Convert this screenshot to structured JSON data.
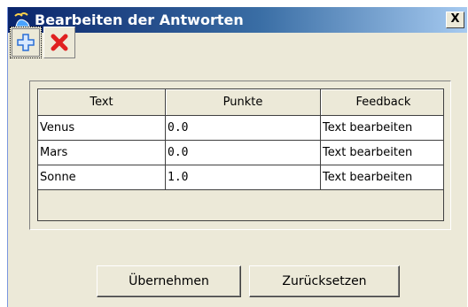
{
  "window": {
    "title": "Bearbeiten der Antworten"
  },
  "titlebar": {
    "close_label": "X"
  },
  "toolbar": {
    "add_icon": "plus-icon",
    "delete_icon": "red-x-icon"
  },
  "table": {
    "columns": [
      "Text",
      "Punkte",
      "Feedback"
    ],
    "rows": [
      {
        "text": "Venus",
        "punkte": "0.0",
        "feedback": "Text bearbeiten"
      },
      {
        "text": "Mars",
        "punkte": "0.0",
        "feedback": "Text bearbeiten"
      },
      {
        "text": "Sonne",
        "punkte": "1.0",
        "feedback": "Text bearbeiten"
      }
    ]
  },
  "buttons": {
    "apply": "Übernehmen",
    "reset": "Zurücksetzen"
  },
  "colors": {
    "titlebar_start": "#0a246a",
    "titlebar_end": "#a6caf0",
    "face": "#ece9d8",
    "delete_red": "#e02020",
    "add_blue": "#2a6fd6"
  }
}
